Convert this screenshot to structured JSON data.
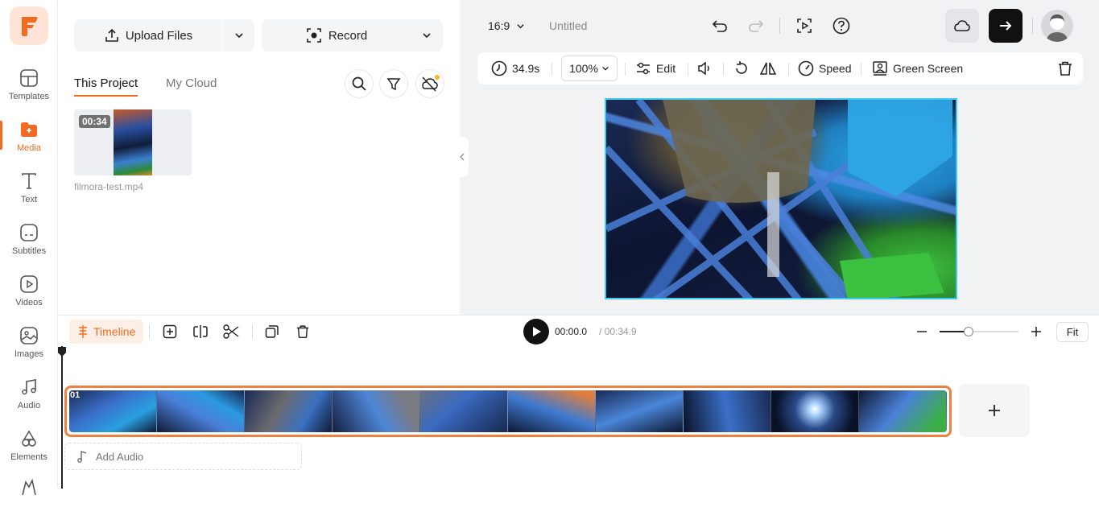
{
  "sidebar": {
    "items": [
      {
        "label": "Templates",
        "icon": "templates-icon"
      },
      {
        "label": "Media",
        "icon": "media-icon",
        "active": true
      },
      {
        "label": "Text",
        "icon": "text-icon"
      },
      {
        "label": "Subtitles",
        "icon": "subtitles-icon"
      },
      {
        "label": "Videos",
        "icon": "videos-icon"
      },
      {
        "label": "Images",
        "icon": "images-icon"
      },
      {
        "label": "Audio",
        "icon": "audio-icon"
      },
      {
        "label": "Elements",
        "icon": "elements-icon"
      }
    ]
  },
  "media_panel": {
    "upload_label": "Upload Files",
    "record_label": "Record",
    "tabs": [
      {
        "label": "This Project",
        "active": true
      },
      {
        "label": "My Cloud",
        "active": false
      }
    ],
    "files": [
      {
        "name": "filmora-test.mp4",
        "duration": "00:34"
      }
    ]
  },
  "header": {
    "aspect_ratio": "16:9",
    "project_name": "Untitled"
  },
  "edit_bar": {
    "duration": "34.9s",
    "zoom": "100%",
    "edit_label": "Edit",
    "speed_label": "Speed",
    "green_screen_label": "Green Screen"
  },
  "timeline": {
    "tab_label": "Timeline",
    "current_time": "00:00.0",
    "total_time": "/ 00:34.9",
    "zoom_level": 0.37,
    "fit_label": "Fit",
    "clip_number": "01",
    "add_audio_label": "Add Audio"
  },
  "colors": {
    "accent": "#f26b21",
    "clip_border": "#f08040",
    "preview_border": "#3cc9f0"
  }
}
